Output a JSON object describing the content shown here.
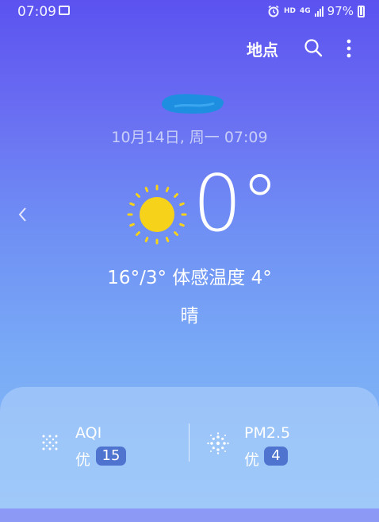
{
  "status_bar": {
    "time": "07:09",
    "hd": "HD",
    "network": "4G",
    "battery": "97%"
  },
  "header": {
    "location_button": "地点"
  },
  "weather": {
    "date_time": "10月14日, 周一 07:09",
    "temperature": "0°",
    "range_feels": "16°/3° 体感温度 4°",
    "condition": "晴"
  },
  "air": {
    "aqi_label": "AQI",
    "aqi_grade": "优",
    "aqi_value": "15",
    "pm_label": "PM2.5",
    "pm_grade": "优",
    "pm_value": "4"
  },
  "colors": {
    "sun": "#f7d21b",
    "badge": "#4e74cf",
    "location_redaction": "#1e8fe0"
  },
  "icons": [
    "gallery-icon",
    "alarm-icon",
    "signal-icon",
    "battery-icon",
    "search-icon",
    "more-vert-icon",
    "chevron-left-icon",
    "sun-icon",
    "aqi-dots-icon",
    "pm25-dots-icon"
  ]
}
